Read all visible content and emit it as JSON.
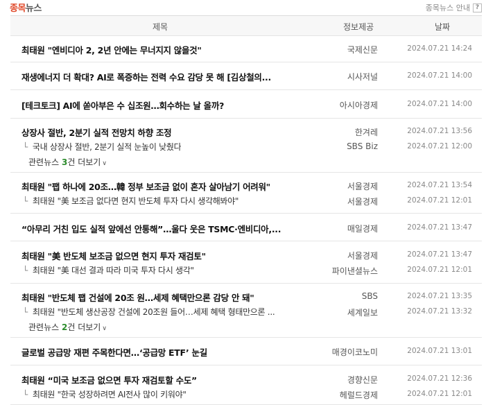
{
  "header": {
    "title_red": "종목",
    "title_gray": "뉴스",
    "guide_label": "종목뉴스 안내",
    "guide_icon": "?"
  },
  "columns": {
    "title": "제목",
    "source": "정보제공",
    "date": "날짜"
  },
  "items": [
    {
      "rows": [
        {
          "title": "최태원 \"엔비디아 2, 2년 안에는 무너지지 않을것\"",
          "source": "국제신문",
          "date": "2024.07.21 14:24"
        }
      ]
    },
    {
      "rows": [
        {
          "title": "재생에너지 더 확대? AI로 폭증하는 전력 수요 감당 못 해 [김상철의...",
          "source": "시사저널",
          "date": "2024.07.21 14:00"
        }
      ]
    },
    {
      "rows": [
        {
          "title": "[테크토크] AI에 쏟아부은 수 십조원…회수하는 날 올까?",
          "source": "아시아경제",
          "date": "2024.07.21 14:00"
        }
      ]
    },
    {
      "rows": [
        {
          "title": "상장사 절반, 2분기 실적 전망치 하향 조정",
          "source": "한겨레",
          "date": "2024.07.21 13:56"
        },
        {
          "title": "국내 상장사 절반, 2분기 실적 눈높이 낮췄다",
          "source": "SBS Biz",
          "date": "2024.07.21 12:00"
        }
      ],
      "related": {
        "prefix": "관련뉴스 ",
        "count": "3",
        "suffix": "건 더보기"
      }
    },
    {
      "rows": [
        {
          "title": "최태원 \"팹 하나에 20조…韓 정부 보조금 없이 혼자 살아남기 어려워\"",
          "source": "서울경제",
          "date": "2024.07.21 13:54"
        },
        {
          "title": "최태원 \"美 보조금 없다면 현지 반도체 투자 다시 생각해봐야\"",
          "source": "서울경제",
          "date": "2024.07.21 12:01"
        }
      ]
    },
    {
      "rows": [
        {
          "title": "“아무리 거친 입도 실적 앞에선 안통해”…울다 웃은 TSMC·엔비디아,...",
          "source": "매일경제",
          "date": "2024.07.21 13:47"
        }
      ]
    },
    {
      "rows": [
        {
          "title": "최태원 \"美 반도체 보조금 없으면 현지 투자 재검토\"",
          "source": "서울경제",
          "date": "2024.07.21 13:47"
        },
        {
          "title": "최태원 \"美 대선 결과 따라 미국 투자 다시 생각\"",
          "source": "파이낸셜뉴스",
          "date": "2024.07.21 12:01"
        }
      ]
    },
    {
      "rows": [
        {
          "title": "최태원 \"반도체 팹 건설에 20조 원…세제 혜택만으론 감당 안 돼\"",
          "source": "SBS",
          "date": "2024.07.21 13:35"
        },
        {
          "title": "최태원 \"반도체 생산공장 건설에 20조원 들어…세제 혜택 형태만으론 ...",
          "source": "세계일보",
          "date": "2024.07.21 13:32"
        }
      ],
      "related": {
        "prefix": "관련뉴스 ",
        "count": "2",
        "suffix": "건 더보기"
      }
    },
    {
      "rows": [
        {
          "title": "글로벌 공급망 재편 주목한다면…‘공급망 ETF’ 눈길",
          "source": "매경이코노미",
          "date": "2024.07.21 13:01"
        }
      ]
    },
    {
      "rows": [
        {
          "title": "최태원 “미국 보조금 없으면 투자 재검토할 수도”",
          "source": "경향신문",
          "date": "2024.07.21 12:36"
        },
        {
          "title": "최태원 \"한국 성장하려면 AI전사 많이 키워야\"",
          "source": "헤럴드경제",
          "date": "2024.07.21 12:01"
        }
      ]
    }
  ]
}
